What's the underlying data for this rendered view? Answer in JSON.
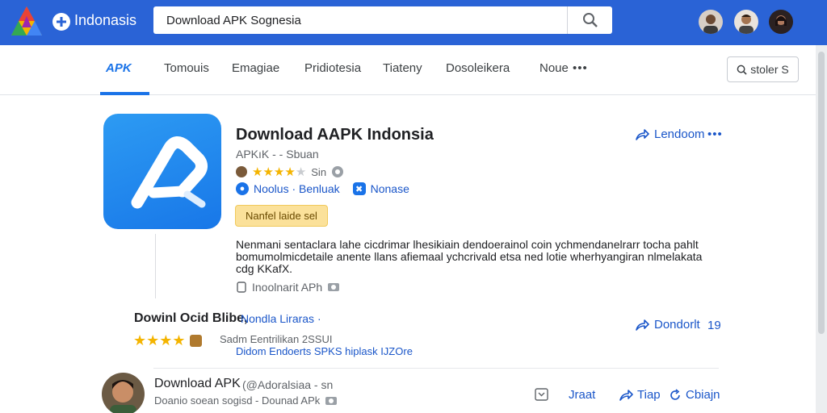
{
  "header": {
    "brand": "Indonasis",
    "search_value": "Download APK Sognesia"
  },
  "nav": {
    "tabs": [
      "APK",
      "Tomouis",
      "Emagiae",
      "Pridiotesia",
      "Tiateny",
      "Dosoleikera",
      "Noue"
    ],
    "more": "•••",
    "share_label": "stoler S"
  },
  "app": {
    "title": "Download AAPK Indonsia",
    "subtitle": "APKıK - - Sbuan",
    "rating_text": "Sin",
    "tag1": "Noolus · Benluak",
    "tag2": "Nonase",
    "badge": "Nanfel laide sel",
    "description": "Nenmani sentaclara lahe cicdrimar lhesikiain dendoerainol coin ychmendanelrarr tocha pahlt bomumolmicdetaile anente llans afiemaal ychcrivald etsa ned lotie wherhyangiran nlmelakata cdg KKafX.",
    "meta": "Inoolnarit APh",
    "download_label": "Lendoom",
    "more": "•••",
    "rating": 4,
    "rating_max": 5
  },
  "listing2": {
    "title": "Dowinl Ocid Blibe,",
    "developer": "Nondla Liraras ·",
    "info": "Sadm Eentrilikan  2SSUI",
    "info2": "Didom Endoerts SPKS hiplask    IJZOre",
    "download_label": "Dondorlt",
    "count": "19",
    "rating": 4,
    "rating_max": 5
  },
  "listing3": {
    "title": "Download APK",
    "developer": "(@Adoralsiaa - sn",
    "subtitle": "Doanio soean sogisd - Dounad APk",
    "actions": [
      "Jraat",
      "Tiap",
      "Cbiajn"
    ]
  },
  "colors": {
    "topbar": "#2a63d6",
    "accent": "#1a73e8",
    "link": "#1a56c9",
    "star": "#f4b400",
    "badge_bg": "#fbe19a"
  }
}
